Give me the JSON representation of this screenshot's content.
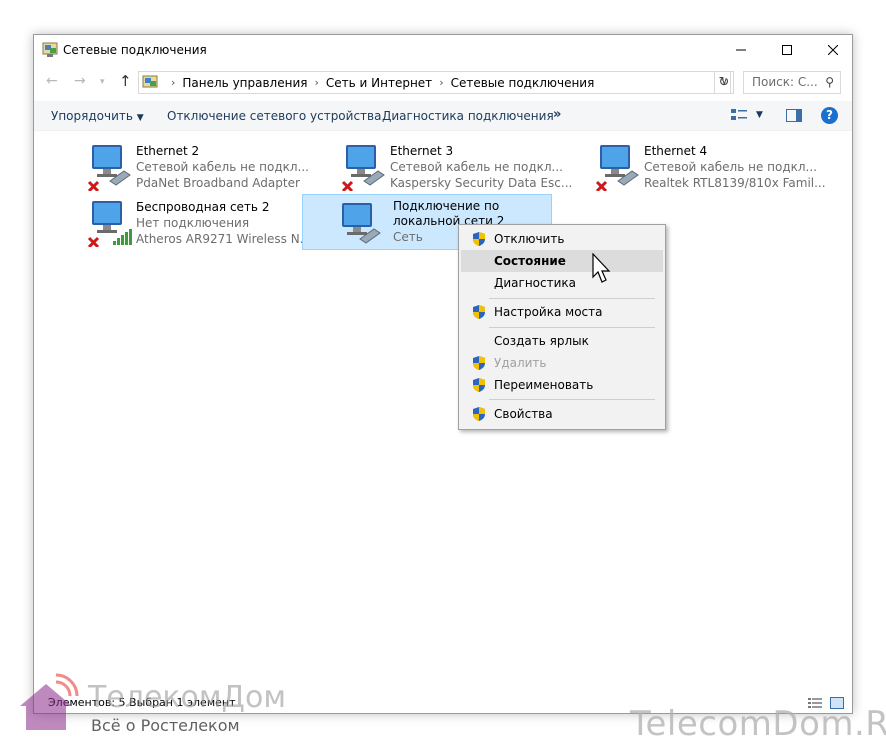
{
  "window": {
    "title": "Сетевые подключения"
  },
  "address": {
    "crumbs": [
      "Панель управления",
      "Сеть и Интернет",
      "Сетевые подключения"
    ],
    "search_placeholder": "Поиск: С..."
  },
  "toolbar": {
    "organize": "Упорядочить",
    "disable_device": "Отключение сетевого устройства",
    "diagnose": "Диагностика подключения",
    "more": "»"
  },
  "connections": [
    {
      "name": "Ethernet 2",
      "status": "Сетевой кабель не подкл...",
      "device": "PdaNet Broadband Adapter",
      "state": "disconnected"
    },
    {
      "name": "Ethernet 3",
      "status": "Сетевой кабель не подкл...",
      "device": "Kaspersky Security Data Esc...",
      "state": "disconnected"
    },
    {
      "name": "Ethernet 4",
      "status": "Сетевой кабель не подкл...",
      "device": "Realtek RTL8139/810x Famil...",
      "state": "disconnected"
    },
    {
      "name": "Беспроводная сеть 2",
      "status": "Нет подключения",
      "device": "Atheros AR9271 Wireless N...",
      "state": "wireless-disconnected"
    },
    {
      "name": "Подключение по",
      "name2": "локальной сети 2",
      "status": "Сеть",
      "state": "connected"
    }
  ],
  "context_menu": {
    "items": [
      {
        "label": "Отключить",
        "shield": true
      },
      {
        "label": "Состояние",
        "shield": false
      },
      {
        "label": "Диагностика",
        "shield": false
      },
      {
        "label": "Настройка моста",
        "shield": true
      },
      {
        "label": "Создать ярлык",
        "shield": false
      },
      {
        "label": "Удалить",
        "shield": true
      },
      {
        "label": "Переименовать",
        "shield": true
      },
      {
        "label": "Свойства",
        "shield": true
      }
    ]
  },
  "statusbar": {
    "text": "Элементов: 5   Выбран 1 элемент"
  },
  "watermark": {
    "brand": "ТелекомДом",
    "sub": "Всё о Ростелеком",
    "right": "TelecomDom.RU"
  }
}
